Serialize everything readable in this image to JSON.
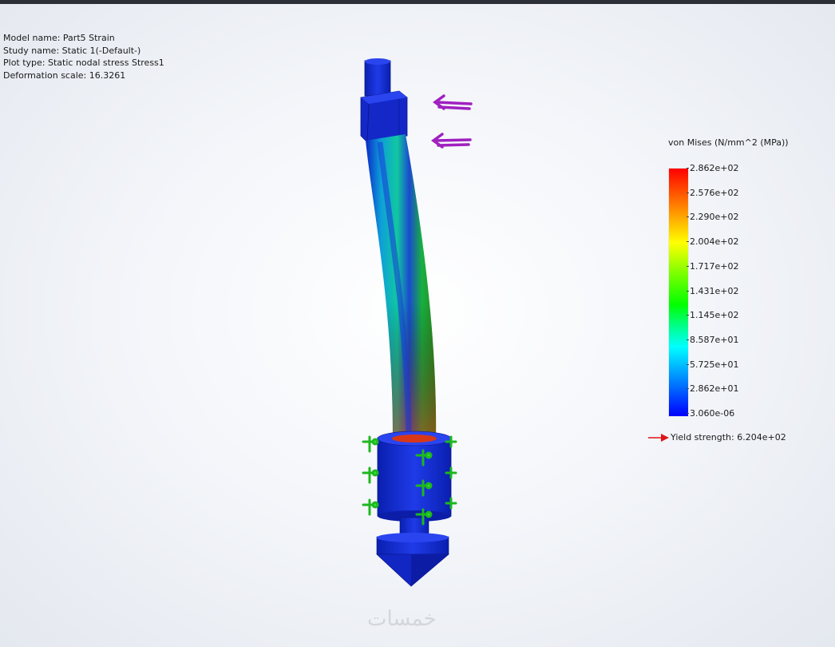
{
  "info": {
    "model_name": "Model name: Part5 Strain",
    "study_name": "Study name: Static 1(-Default-)",
    "plot_type": "Plot type: Static nodal stress Stress1",
    "deformation_scale": "Deformation scale: 16.3261"
  },
  "legend": {
    "title": "von Mises (N/mm^2 (MPa))",
    "ticks": [
      "2.862e+02",
      "2.576e+02",
      "2.290e+02",
      "2.004e+02",
      "1.717e+02",
      "1.431e+02",
      "1.145e+02",
      "8.587e+01",
      "5.725e+01",
      "2.862e+01",
      "3.060e-06"
    ],
    "yield_strength": "Yield strength: 6.204e+02"
  },
  "colors": {
    "part_blue": "#1a2fd6",
    "load_arrow": "#a020c0",
    "fixture": "#22cc22",
    "yield_arrow": "#e0151b"
  },
  "icons": {
    "load": "force-arrow-icon",
    "fixture": "fixture-icon",
    "yield": "yield-arrow-icon"
  },
  "watermark": "خمسات"
}
